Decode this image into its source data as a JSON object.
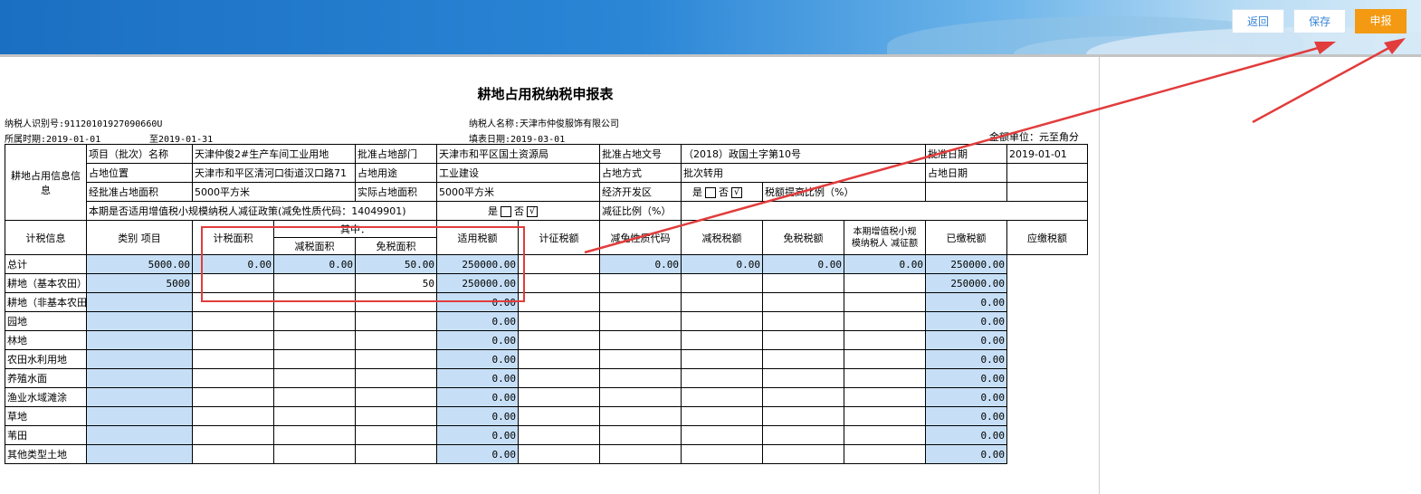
{
  "buttons": {
    "back": "返回",
    "save": "保存",
    "submit": "申报"
  },
  "title": "耕地占用税纳税申报表",
  "meta": {
    "taxpayer_id": "纳税人识别号:91120101927090660U",
    "taxpayer_name": "纳税人名称:天津市仲俊服饰有限公司",
    "period_from": "所属时期:2019-01-01",
    "period_to": "至2019-01-31",
    "fill_date": "填表日期:2019-03-01",
    "unit": "金额单位：元至角分"
  },
  "info": {
    "section_label": "耕地占用信息信息",
    "project_name_label": "项目（批次）名称",
    "project_name": "天津仲俊2#生产车间工业用地",
    "approval_dept_label": "批准占地部门",
    "approval_dept": "天津市和平区国土资源局",
    "approval_doc_label": "批准占地文号",
    "approval_doc": "（2018）政国土字第10号",
    "approval_date_label": "批准日期",
    "approval_date": "2019-01-01",
    "location_label": "占地位置",
    "location": "天津市和平区清河口街道汉口路71",
    "use_label": "占地用途",
    "use": "工业建设",
    "method_label": "占地方式",
    "method": "批次转用",
    "occupy_date_label": "占地日期",
    "approved_area_label": "经批准占地面积",
    "approved_area": "5000平方米",
    "actual_area_label": "实际占地面积",
    "actual_area": "5000平方米",
    "econ_zone_label": "经济开发区",
    "yes": "是",
    "no": "否",
    "check": "√",
    "ratio_label": "税额提高比例（%）",
    "policy_label": "本期是否适用增值税小规模纳税人减征政策(减免性质代码：14049901)",
    "reduce_ratio_label": "减征比例（%）"
  },
  "calc": {
    "section_label": "计税信息",
    "headers": {
      "category": "类别 项目",
      "taxable_area": "计税面积",
      "among": "其中：",
      "reduced_area": "减税面积",
      "exempt_area": "免税面积",
      "rate": "适用税额",
      "levy": "计征税额",
      "code": "减免性质代码",
      "reduced_tax": "减税税额",
      "exempt_tax": "免税税额",
      "small_scale_line1": "本期增值税小规",
      "small_scale_line2": "模纳税人 减征额",
      "paid": "已缴税额",
      "due": "应缴税额"
    },
    "rows": [
      {
        "name": "总计",
        "area": "5000.00",
        "reduced": "0.00",
        "exempt": "0.00",
        "rate": "50.00",
        "levy": "250000.00",
        "reduced_tax": "0.00",
        "exempt_tax": "0.00",
        "small": "0.00",
        "paid": "0.00",
        "due": "250000.00"
      },
      {
        "name": "耕地（基本农田）",
        "area": "5000",
        "rate": "50",
        "levy": "250000.00",
        "due": "250000.00"
      },
      {
        "name": "耕地（非基本农田）",
        "levy": "0.00",
        "due": "0.00"
      },
      {
        "name": "园地",
        "levy": "0.00",
        "due": "0.00"
      },
      {
        "name": "林地",
        "levy": "0.00",
        "due": "0.00"
      },
      {
        "name": "农田水利用地",
        "levy": "0.00",
        "due": "0.00"
      },
      {
        "name": "养殖水面",
        "levy": "0.00",
        "due": "0.00"
      },
      {
        "name": "渔业水域滩涂",
        "levy": "0.00",
        "due": "0.00"
      },
      {
        "name": "草地",
        "levy": "0.00",
        "due": "0.00"
      },
      {
        "name": "苇田",
        "levy": "0.00",
        "due": "0.00"
      },
      {
        "name": "其他类型土地",
        "levy": "0.00",
        "due": "0.00"
      }
    ]
  },
  "annotation_color": "#e23c3c"
}
